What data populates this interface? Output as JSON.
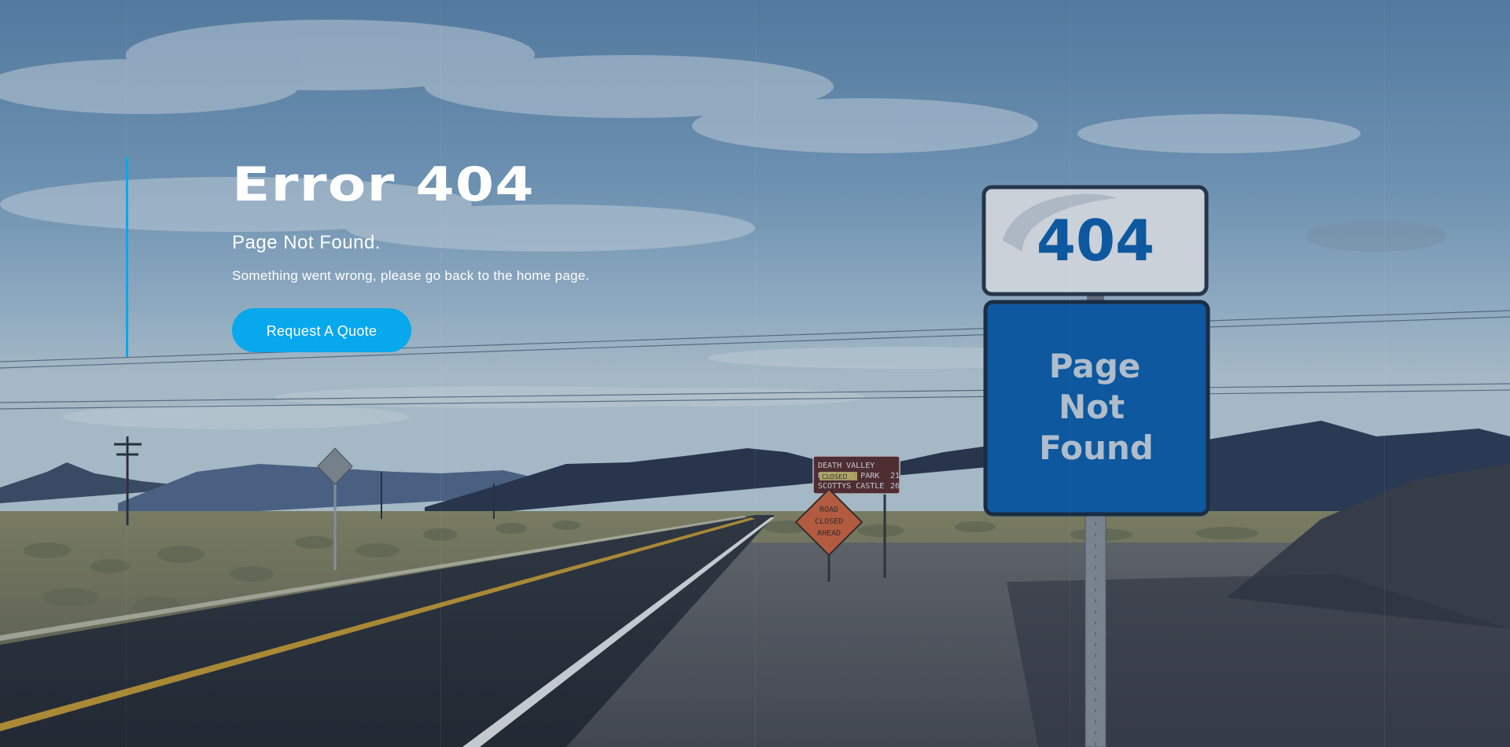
{
  "hero": {
    "title": "Error 404",
    "subtitle": "Page Not Found.",
    "description": "Something went wrong, please go back to the home page.",
    "cta_label": "Request A Quote"
  },
  "scene": {
    "sign": {
      "top_text": "404",
      "bottom_lines": [
        "Page",
        "Not",
        "Found"
      ]
    },
    "road_sign": {
      "lines": [
        "ROAD",
        "CLOSED",
        "AHEAD"
      ]
    },
    "distance_sign": {
      "rows": [
        {
          "label": "DEATH VALLEY",
          "value": ""
        },
        {
          "label": "NATIONAL PARK",
          "value": "21"
        },
        {
          "label": "SCOTTYS CASTLE",
          "value": "26"
        }
      ],
      "tag": "CLOSED"
    }
  },
  "colors": {
    "accent": "#08a8ec",
    "sign_blue": "#0a5fae",
    "white": "#ffffff"
  }
}
